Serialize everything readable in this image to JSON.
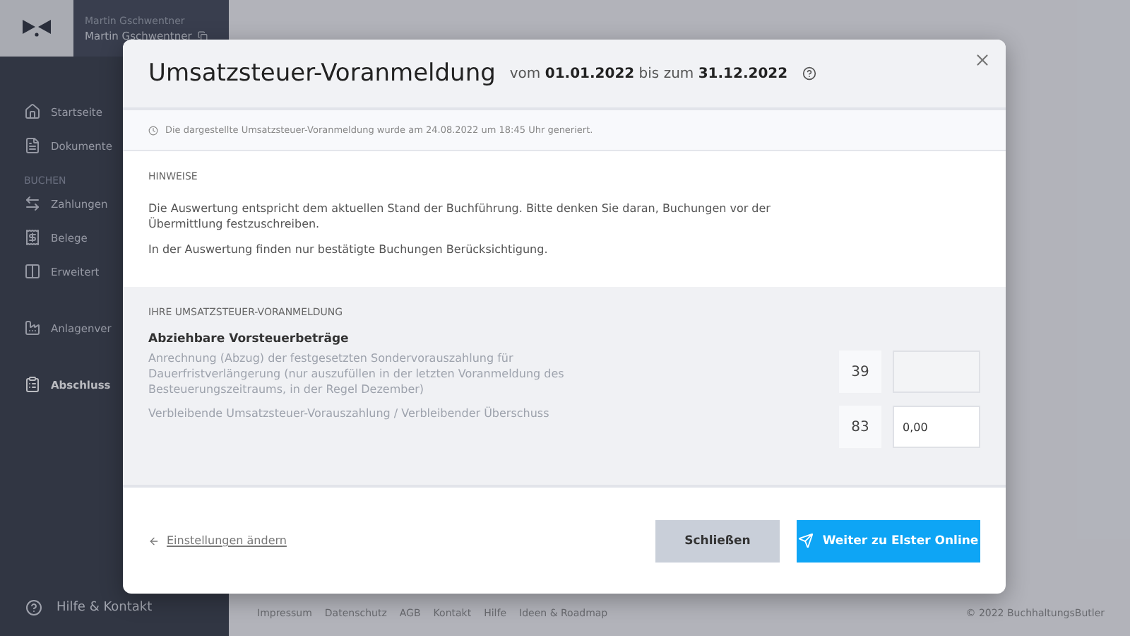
{
  "sidebar": {
    "user": {
      "name": "Martin Gschwentner",
      "company": "Martin Gschwentner"
    },
    "items": [
      {
        "kind": "item",
        "label": "Startseite",
        "selected": false
      },
      {
        "kind": "item",
        "label": "Dokumente",
        "selected": false
      },
      {
        "kind": "heading",
        "label": "BUCHEN"
      },
      {
        "kind": "item",
        "label": "Zahlungen",
        "selected": false
      },
      {
        "kind": "item",
        "label": "Belege",
        "selected": false
      },
      {
        "kind": "item",
        "label": "Erweitert",
        "selected": false
      },
      {
        "kind": "item",
        "label": "Anlagenver",
        "selected": false
      },
      {
        "kind": "item",
        "label": "Abschluss",
        "selected": true
      }
    ],
    "help": "Hilfe & Kontakt"
  },
  "footer": {
    "links": [
      "Impressum",
      "Datenschutz",
      "AGB",
      "Kontakt",
      "Hilfe",
      "Ideen & Roadmap"
    ],
    "copyright": "© 2022 BuchhaltungsButler"
  },
  "dialog": {
    "title": "Umsatzsteuer-Voranmeldung",
    "subtitle": "vom **01.01.2022** bis zum **31.12.2022**",
    "generated": "Die dargestellte Umsatzsteuer-Voranmeldung wurde am 24.08.2022 um 18:45 Uhr generiert.",
    "notes_heading": "HINWEISE",
    "notes": [
      "Die Auswertung entspricht dem aktuellen Stand der Buchführung. Bitte denken Sie daran, Buchungen vor der Übermittlung festzuschreiben.",
      "In der Auswertung finden nur bestätigte Buchungen Berücksichtigung."
    ],
    "form_heading": "IHRE UMSATZSTEUER-VORANMELDUNG",
    "group_title": "Abziehbare Vorsteuerbeträge",
    "rows": [
      {
        "label": "Anrechnung (Abzug) der festgesetzten Sondervorauszahlung für Dauerfristverlängerung (nur auszufüllen in der letzten Voranmeldung des Besteuerungszeitraums, in der Regel Dezember)",
        "code": "39",
        "value": "",
        "disabled": true
      },
      {
        "label": "Verbleibende Umsatzsteuer-Vorauszahlung / Verbleibender Überschuss",
        "code": "83",
        "value": "0,00",
        "disabled": false
      }
    ],
    "back_link": "Einstellungen ändern",
    "buttons": [
      {
        "kind": "secondary",
        "label": "Schließen"
      },
      {
        "kind": "primary",
        "label": "Weiter zu Elster Online"
      }
    ]
  }
}
